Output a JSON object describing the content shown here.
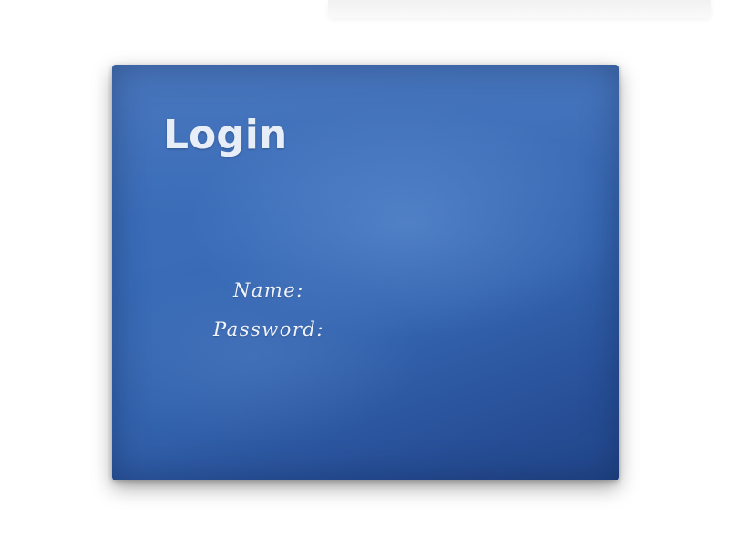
{
  "login": {
    "title": "Login",
    "name_label": "Name:",
    "password_label": "Password:",
    "name_value": "",
    "password_value": ""
  },
  "colors": {
    "panel_blue": "#3a6cb8",
    "panel_dark_blue": "#22468a",
    "text": "#e8eef8"
  }
}
